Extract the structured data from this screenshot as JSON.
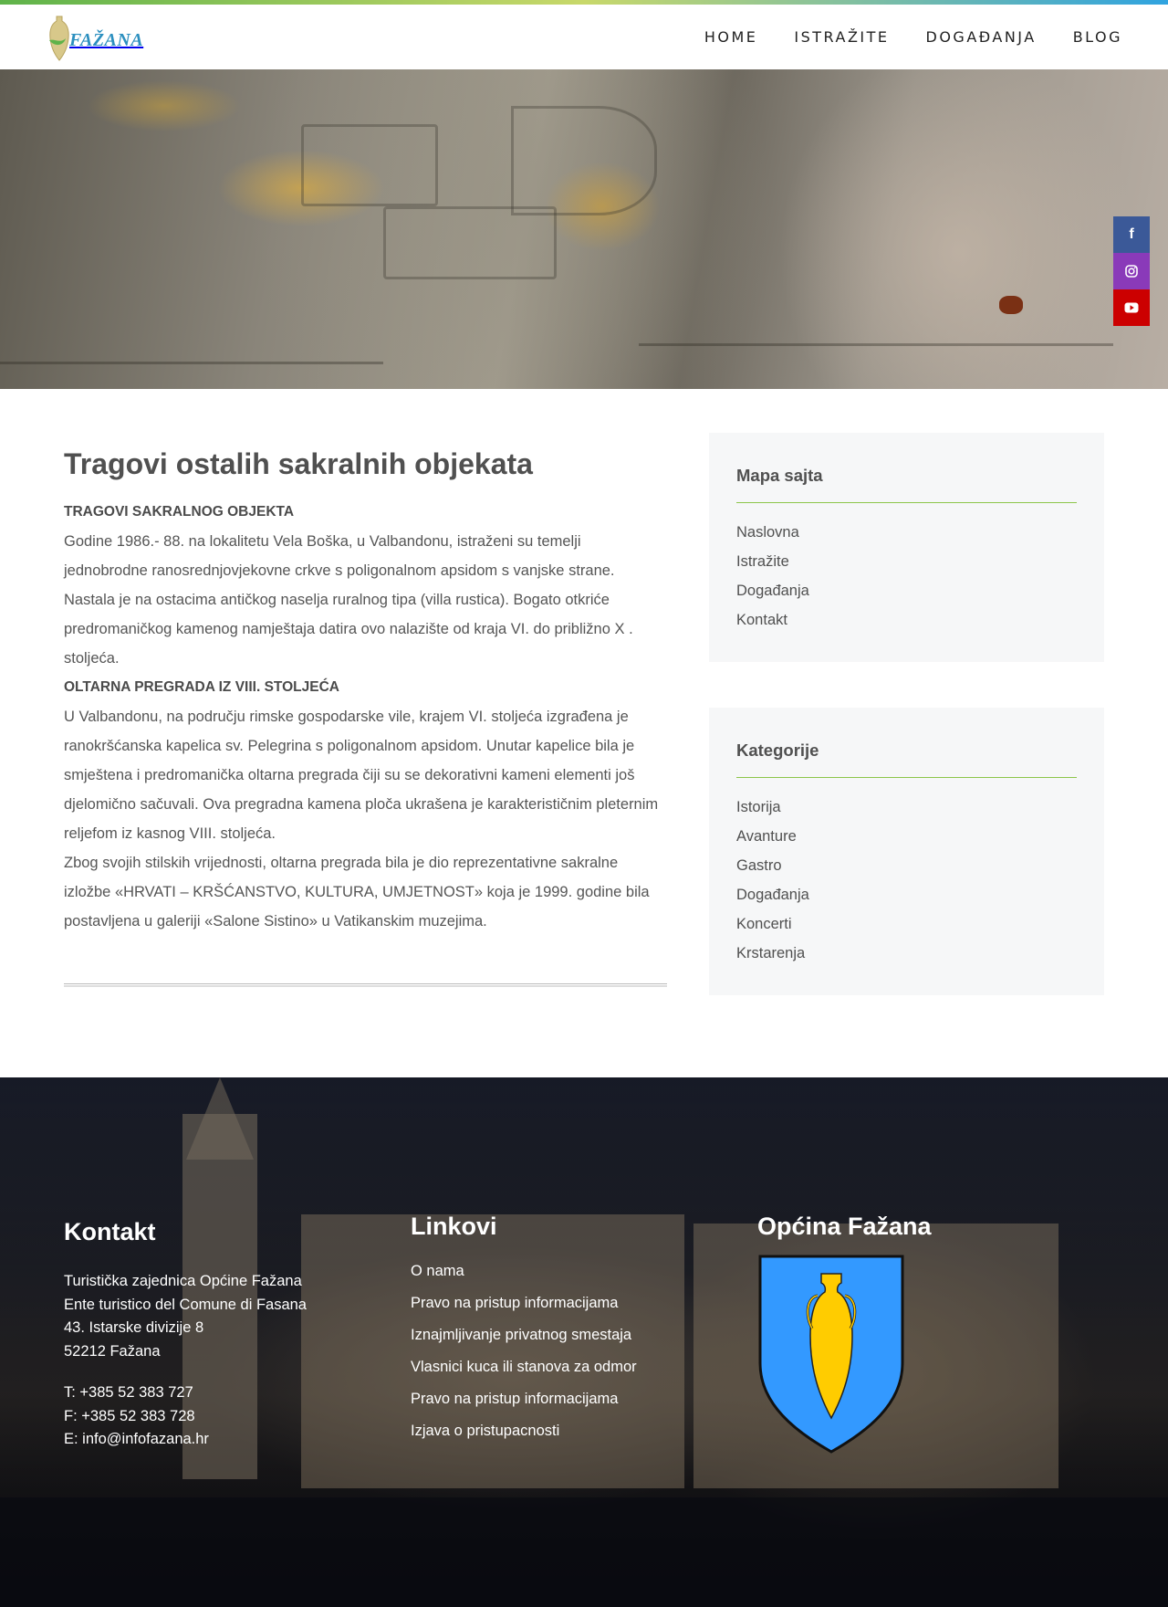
{
  "brand": {
    "logo_text": "FAŽANA",
    "accent": "#8cc64a"
  },
  "nav": [
    {
      "label": "HOME"
    },
    {
      "label": "ISTRAŽITE"
    },
    {
      "label": "DOGAĐANJA"
    },
    {
      "label": "BLOG"
    }
  ],
  "social": {
    "facebook_glyph": "f",
    "instagram_icon": "instagram-icon",
    "youtube_icon": "youtube-icon",
    "colors": {
      "facebook": "#3b5998",
      "instagram": "#8a3ab9",
      "youtube": "#cc0000"
    }
  },
  "article": {
    "title": "Tragovi ostalih sakralnih objekata",
    "section1_heading": "TRAGOVI SAKRALNOG OBJEKTA",
    "section1_text": "Godine 1986.- 88. na lokalitetu Vela Boška, u Valbandonu, istraženi su temelji jednobrodne ranosrednjovjekovne crkve s poligonalnom apsidom s vanjske strane. Nastala je na ostacima antičkog naselja ruralnog tipa (villa rustica). Bogato otkriće predromaničkog kamenog namještaja datira ovo nalazište od kraja VI. do približno X . stoljeća.",
    "section2_heading": "OLTARNA PREGRADA IZ VIII. STOLJEĆA",
    "section2_text1": "U Valbandonu, na području rimske gospodarske vile, krajem VI. stoljeća izgrađena je ranokršćanska kapelica sv. Pelegrina s poligonalnom apsidom. Unutar kapelice bila je smještena i predromanička oltarna pregrada čiji su se dekorativni kameni elementi još djelomično sačuvali. Ova pregradna kamena ploča ukrašena je karakterističnim pleternim reljefom iz kasnog VIII. stoljeća.",
    "section2_text2": "Zbog svojih stilskih vrijednosti, oltarna pregrada bila je dio reprezentativne sakralne izložbe «HRVATI – KRŠĆANSTVO, KULTURA, UMJETNOST» koja je 1999. godine bila postavljena u galeriji «Salone Sistino» u Vatikanskim muzejima."
  },
  "sidebar": {
    "sitemap_title": "Mapa sajta",
    "sitemap_links": [
      "Naslovna",
      "Istražite",
      "Događanja",
      "Kontakt"
    ],
    "categories_title": "Kategorije",
    "categories_links": [
      "Istorija",
      "Avanture",
      "Gastro",
      "Događanja",
      "Koncerti",
      "Krstarenja"
    ]
  },
  "footer": {
    "contact_title": "Kontakt",
    "address_line1": "Turistička zajednica Općine Fažana",
    "address_line2": "Ente turistico del Comune di Fasana",
    "address_line3": "43. Istarske divizije 8",
    "address_line4": "52212 Fažana",
    "phone": "T: +385 52 383 727",
    "fax": "F: +385 52 383 728",
    "email": "E: info@infofazana.hr",
    "links_title": "Linkovi",
    "links": [
      "O nama",
      "Pravo na pristup informacijama",
      "Iznajmljivanje privatnog smestaja",
      "Vlasnici kuca ili stanova za odmor",
      "Pravo na pristup informacijama",
      "Izjava o pristupacnosti"
    ],
    "municipality_title": "Općina Fažana",
    "coat_colors": {
      "shield": "#3399ff",
      "amphora": "#ffcc00"
    }
  }
}
